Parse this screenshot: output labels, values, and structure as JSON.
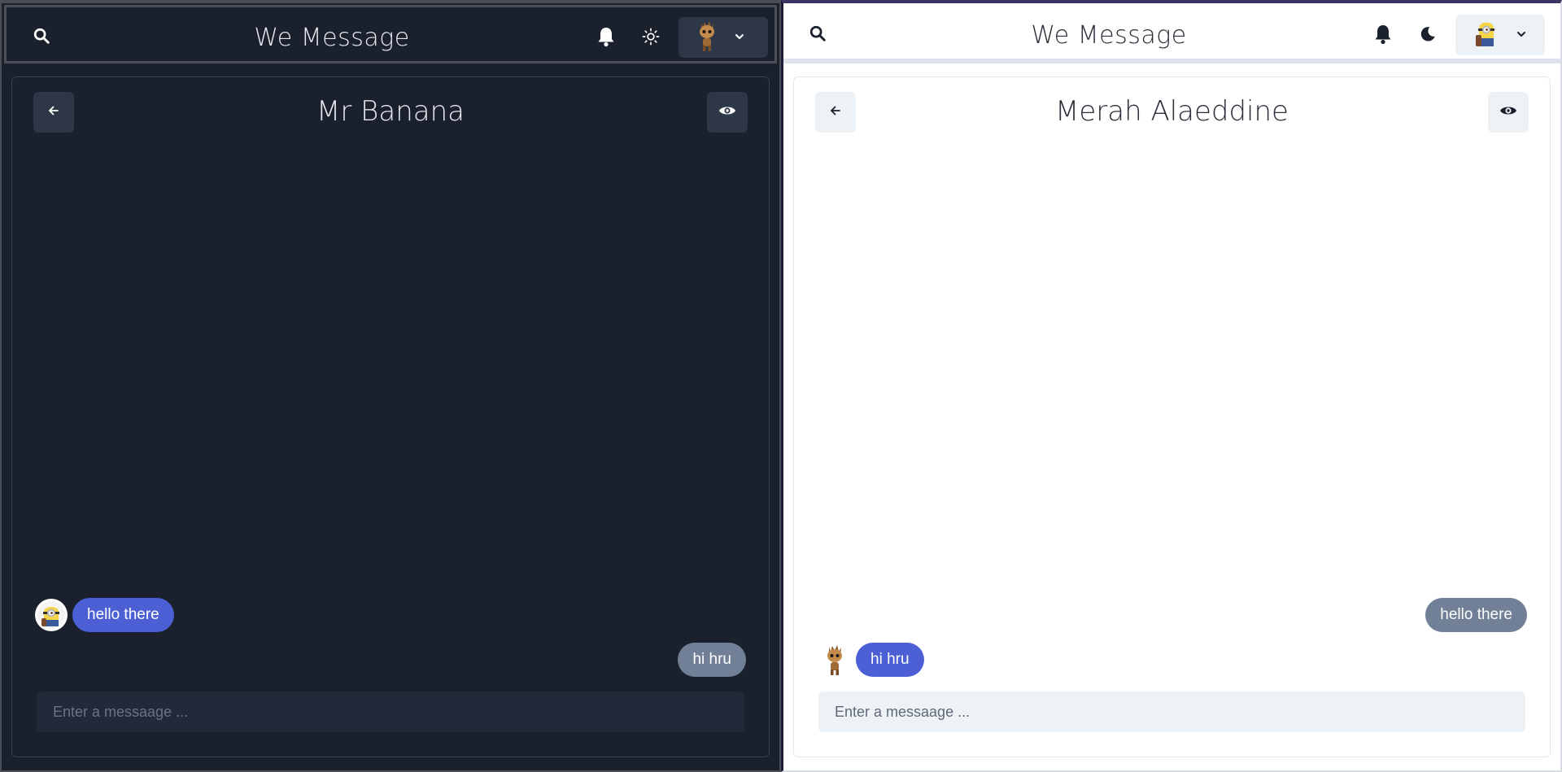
{
  "colors": {
    "dark_bg": "#1a202c",
    "light_bg": "#ffffff",
    "bubble_blue": "#4c5fd5",
    "bubble_gray": "#718096"
  },
  "dark_pane": {
    "header": {
      "title": "We Message",
      "search_icon": "search-icon",
      "bell_icon": "bell-icon",
      "theme_icon": "sun-icon",
      "avatar_icon": "groot-avatar",
      "chevron_icon": "chevron-down-icon"
    },
    "chat": {
      "title": "Mr Banana",
      "back_icon": "arrow-left-icon",
      "view_icon": "eye-icon",
      "messages": [
        {
          "text": "hello there",
          "from": "other",
          "avatar": "minion-avatar"
        },
        {
          "text": "hi hru",
          "from": "me"
        }
      ],
      "input_placeholder": "Enter a messaage ..."
    }
  },
  "light_pane": {
    "header": {
      "title": "We Message",
      "search_icon": "search-icon",
      "bell_icon": "bell-icon",
      "theme_icon": "moon-icon",
      "avatar_icon": "minion-avatar",
      "chevron_icon": "chevron-down-icon"
    },
    "chat": {
      "title": "Merah Alaeddine",
      "back_icon": "arrow-left-icon",
      "view_icon": "eye-icon",
      "messages": [
        {
          "text": "hello there",
          "from": "me"
        },
        {
          "text": "hi hru",
          "from": "other",
          "avatar": "groot-avatar"
        }
      ],
      "input_placeholder": "Enter a messaage ..."
    }
  }
}
